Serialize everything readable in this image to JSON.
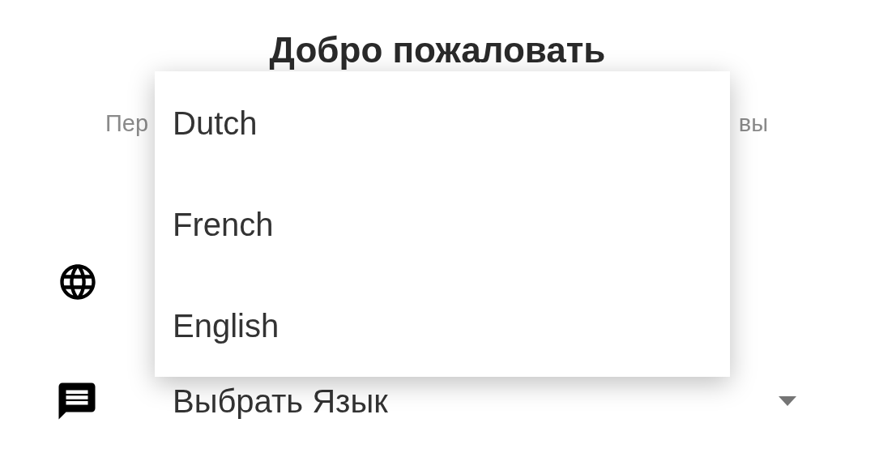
{
  "title": "Добро пожаловать",
  "subtitle": {
    "start": "Пер",
    "end": "вы"
  },
  "language_select": {
    "value": "Выбрать Язык",
    "expanded": true
  },
  "menu": [
    {
      "label": "Dutch"
    },
    {
      "label": "French"
    },
    {
      "label": "English"
    }
  ]
}
